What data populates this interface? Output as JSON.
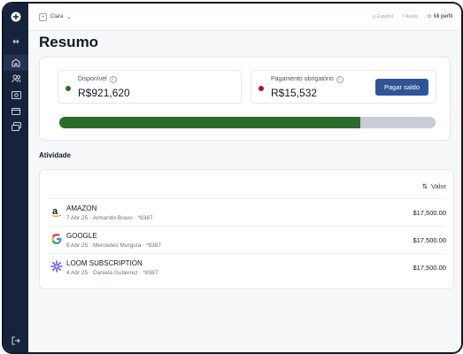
{
  "topbar": {
    "org": "Clara",
    "lang": "Español",
    "help": "Ayuda",
    "profile": "Mi perfil"
  },
  "page_title": "Resumo",
  "summary": {
    "available_label": "Disponível",
    "available_amount": "R$921,620",
    "payment_label": "Pagamento obrigatório",
    "payment_amount": "R$15,532",
    "pay_button": "Pagar saldo",
    "progress_fraction": 0.8,
    "colors": {
      "available": "#2e6b2a",
      "payment": "#b0151f",
      "button": "#2f5597"
    }
  },
  "activity": {
    "title": "Atividade",
    "value_header": "Valor",
    "rows": [
      {
        "icon": "amazon-logo",
        "name": "AMAZON",
        "meta": "7 Abr 25 · Armando Bravo · *8387",
        "value": "$17,500.00"
      },
      {
        "icon": "google-logo",
        "name": "GOOGLE",
        "meta": "6 Abr 25 · Mercedes Murguía · *8387",
        "value": "$17,500.00"
      },
      {
        "icon": "loom-logo",
        "name": "LOOM SUBSCRIPTION",
        "meta": "4 Abr 25 · Daniela Gutiérrez · *8387",
        "value": "$17,500.00"
      }
    ]
  },
  "sidebar": {
    "icons": [
      "plus-icon",
      "collapse-icon",
      "home-icon",
      "users-icon",
      "money-icon",
      "wallet-icon",
      "cards-icon",
      "logout-icon"
    ]
  }
}
